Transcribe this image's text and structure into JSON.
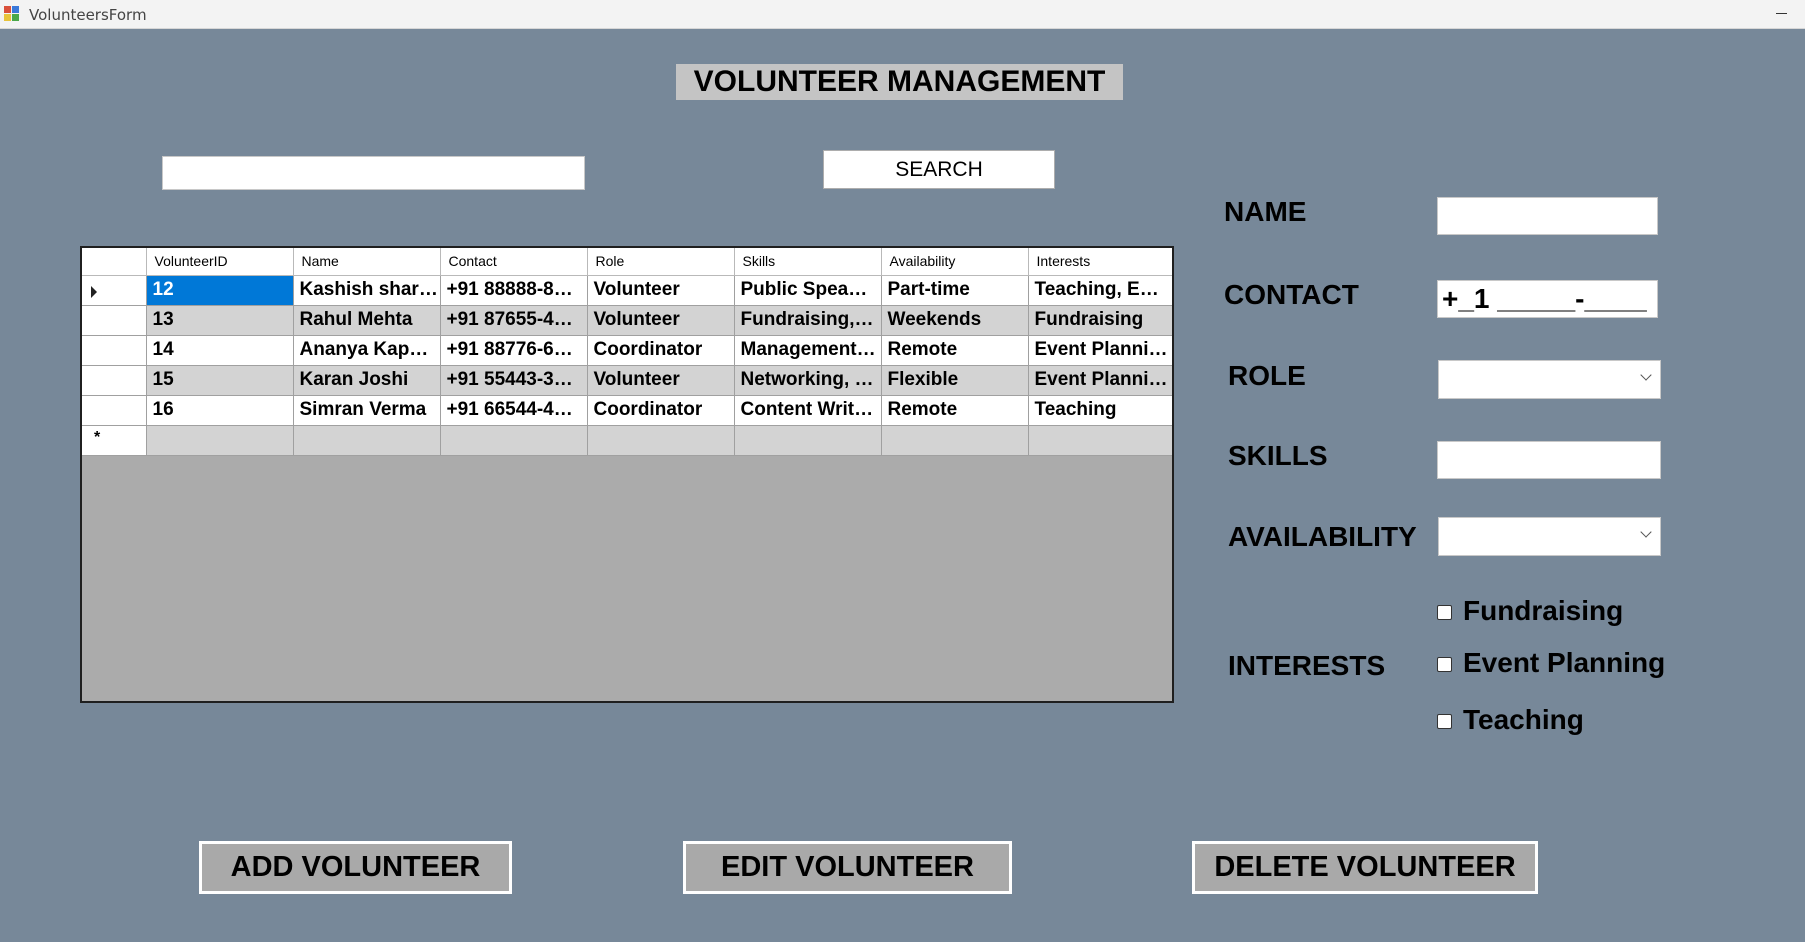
{
  "window": {
    "title": "VolunteersForm"
  },
  "header": {
    "title": "VOLUNTEER MANAGEMENT"
  },
  "search": {
    "value": "",
    "button_label": "SEARCH"
  },
  "grid": {
    "columns": [
      "VolunteerID",
      "Name",
      "Contact",
      "Role",
      "Skills",
      "Availability",
      "Interests"
    ],
    "rows": [
      [
        "12",
        "Kashish shar…",
        "+91 88888-8…",
        "Volunteer",
        "Public Spea…",
        "Part-time",
        "Teaching, E…"
      ],
      [
        "13",
        "Rahul Mehta",
        "+91 87655-4…",
        "Volunteer",
        "Fundraising,…",
        "Weekends",
        "Fundraising"
      ],
      [
        "14",
        "Ananya Kap…",
        "+91 88776-6…",
        "Coordinator",
        "Management…",
        "Remote",
        "Event Planni…"
      ],
      [
        "15",
        "Karan Joshi",
        "+91 55443-3…",
        "Volunteer",
        "Networking, …",
        "Flexible",
        "Event Planni…"
      ],
      [
        "16",
        "Simran Verma",
        "+91 66544-4…",
        "Coordinator",
        "Content Writ…",
        "Remote",
        "Teaching"
      ]
    ],
    "new_row_marker": "*"
  },
  "form": {
    "name_label": "NAME",
    "name_value": "",
    "contact_label": "CONTACT",
    "contact_value": "+_1 _____-____",
    "role_label": "ROLE",
    "role_value": "",
    "skills_label": "SKILLS",
    "skills_value": "",
    "availability_label": "AVAILABILITY",
    "availability_value": "",
    "interests_label": "INTERESTS",
    "interests": [
      {
        "label": "Fundraising",
        "checked": false
      },
      {
        "label": "Event Planning",
        "checked": false
      },
      {
        "label": "Teaching",
        "checked": false
      }
    ]
  },
  "actions": {
    "add_label": "ADD VOLUNTEER",
    "edit_label": "EDIT VOLUNTEER",
    "delete_label": "DELETE VOLUNTEER"
  },
  "colors": {
    "background": "#778899",
    "selection": "#0078d7",
    "grid_empty": "#ababab",
    "title_bg": "#c4c4c4"
  }
}
